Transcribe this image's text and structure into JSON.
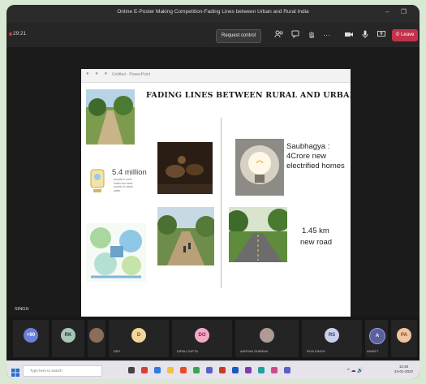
{
  "window": {
    "title": "Online E-Poster Making Competition-Fading Lines between Urban and Rural India",
    "controls": "–  ❐"
  },
  "toolbar": {
    "timer": "29:21",
    "request_control": "Request control",
    "more": "···",
    "leave_label": "Leave"
  },
  "slide": {
    "app_dots": "● ● ●",
    "file_name": "Untitled - PowerPoint",
    "title": "FADING LINES BETWEEN RURAL AND URBAN INDIA",
    "stat_big": "5.4 million",
    "stat_small": "people in rural India now have access to clean water",
    "caption_saubhagya": "Saubhagya : 4Crore new electrified homes",
    "caption_road_value": "1.45 km",
    "caption_road_label": "new road"
  },
  "speaker": {
    "name": "SINGH"
  },
  "participants": [
    {
      "initials": "+90",
      "name": "",
      "color": "#6b7fd7"
    },
    {
      "initials": "RK",
      "name": "",
      "color": "#a8c6b6"
    },
    {
      "initials": "",
      "name": "",
      "color": "#8a6e5a"
    },
    {
      "initials": "D",
      "name": "DEV",
      "color": "#f1d89a"
    },
    {
      "initials": "DO",
      "name": "DIPALI DATTA",
      "color": "#f3a9c5"
    },
    {
      "initials": "",
      "name": "AARYAN SHARMA",
      "color": "#b09a93"
    },
    {
      "initials": "RS",
      "name": "RIYA SINGH",
      "color": "#c9d1ea"
    },
    {
      "initials": "A",
      "name": "ANIKET",
      "color": "#5a5f9e"
    },
    {
      "initials": "PA",
      "name": "",
      "color": "#f2c39f"
    }
  ],
  "taskbar": {
    "search_placeholder": "Type here to search",
    "time": "12:45",
    "date": "24-01-2022"
  }
}
